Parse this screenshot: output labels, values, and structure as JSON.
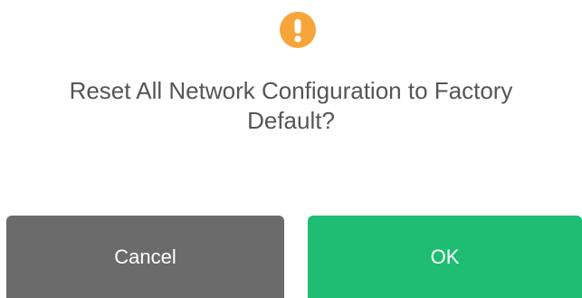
{
  "dialog": {
    "icon": "warning-exclamation-icon",
    "accent_color": "#f5a53a",
    "message_line1": "Reset All Network Configuration to Factory",
    "message_line2": "Default?",
    "cancel_label": "Cancel",
    "ok_label": "OK",
    "cancel_color": "#6b6b6b",
    "ok_color": "#1fbd73"
  }
}
